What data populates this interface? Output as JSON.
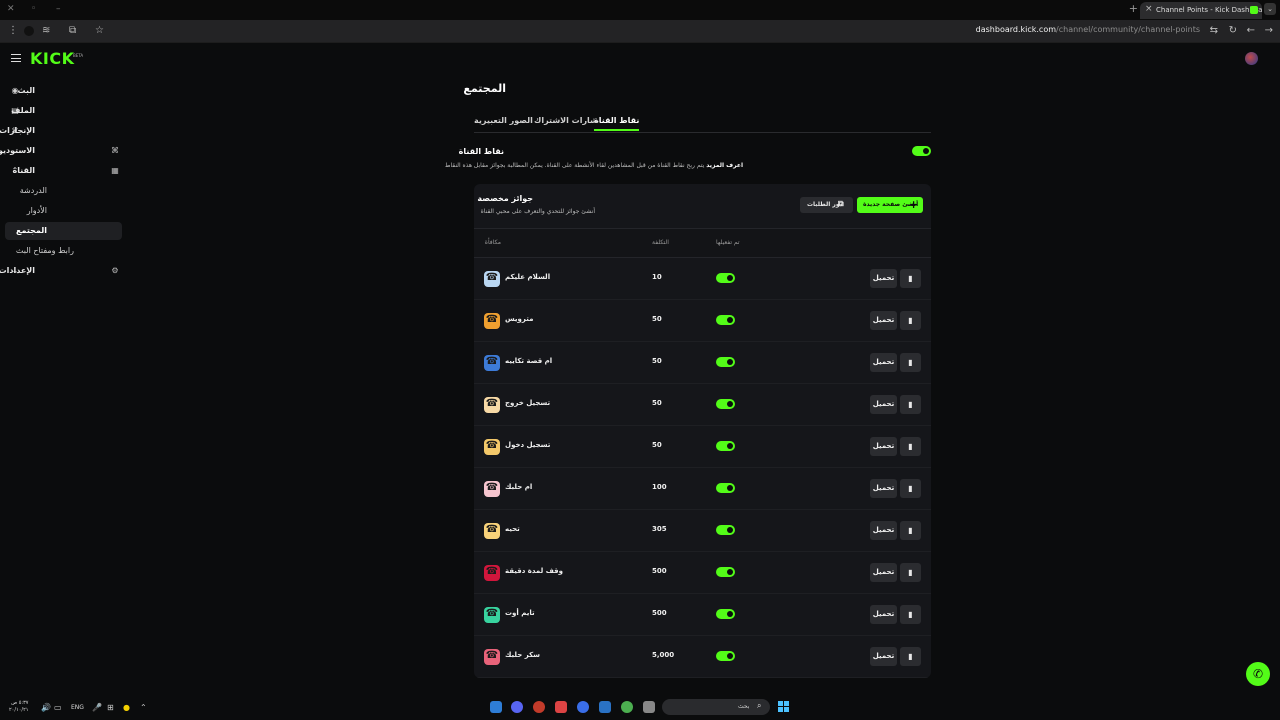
{
  "browser": {
    "tab_title": "Channel Points - Kick Dashboard",
    "url_host": "dashboard.kick.com",
    "url_path": "/channel/community/channel-points",
    "new_tab_glyph": "+",
    "tab_close_glyph": "×",
    "menu_glyph": "⌄"
  },
  "app": {
    "logo": "KICK",
    "logo_badge": "BETA"
  },
  "sidebar": {
    "items": [
      {
        "label": "البث",
        "icon": "broadcast-icon",
        "glyph": "((•))"
      },
      {
        "label": "الملف",
        "icon": "profile-icon",
        "glyph": "▤"
      },
      {
        "label": "الإنجازات",
        "icon": "trophy-icon",
        "glyph": "🏆"
      },
      {
        "label": "الاستوديو",
        "icon": "studio-icon",
        "glyph": "⌄",
        "right_glyph": "⌘"
      },
      {
        "label": "القناة",
        "icon": "channel-icon",
        "glyph": "⌃",
        "right_glyph": "▦"
      },
      {
        "label": "الدردشة",
        "sub": true
      },
      {
        "label": "الأدوار",
        "sub": true
      },
      {
        "label": "المجتمع",
        "sub": true,
        "active": true
      },
      {
        "label": "رابط ومفتاح البث",
        "sub": true
      },
      {
        "label": "الإعدادات",
        "icon": "settings-icon",
        "glyph": "⌄",
        "right_glyph": "⚙"
      }
    ]
  },
  "main": {
    "title": "المجتمع",
    "tabs": [
      {
        "label": "نقاط القناة",
        "active": true
      },
      {
        "label": "شارات الاشتراك"
      },
      {
        "label": "الصور التعبيرية"
      }
    ],
    "section_title": "نقاط القناة",
    "section_desc_bold": "اعرف المزيد",
    "section_desc": "يتم ربح نقاط القناة من قبل المشاهدين لقاء الأنشطة على القناة. يمكن المطالبة بجوائز مقابل هذه النقاط",
    "card": {
      "title": "جوائز مخصصة",
      "subtitle": "أنشئ جوائز للتحدي والتعرف على محبي القناة",
      "create_button": "أنشئ صفحة جديدة",
      "history_button": "دور الطلبات",
      "columns": {
        "reward": "مكافأة",
        "cost": "التكلفة",
        "enabled": "تم تفعيلها"
      },
      "edit_label": "تحميل",
      "delete_glyph": "🗑",
      "rows": [
        {
          "name": "السلام عليكم",
          "cost": "10",
          "color": "#b9d6f2"
        },
        {
          "name": "مترويس",
          "cost": "50",
          "color": "#f0a030"
        },
        {
          "name": "ام قصة تكاييه",
          "cost": "50",
          "color": "#3d7bd8"
        },
        {
          "name": "تسجيل خروج",
          "cost": "50",
          "color": "#f7d9a6"
        },
        {
          "name": "تسجيل دخول",
          "cost": "50",
          "color": "#f3c86a"
        },
        {
          "name": "ام حلبك",
          "cost": "100",
          "color": "#f6c5cf"
        },
        {
          "name": "تحيه",
          "cost": "305",
          "color": "#f8d27a"
        },
        {
          "name": "وقف لمدة دقيقة",
          "cost": "500",
          "color": "#d2163c"
        },
        {
          "name": "تايم أوت",
          "cost": "500",
          "color": "#38d39f"
        },
        {
          "name": "سكر حلبك",
          "cost": "5,000",
          "color": "#e8637a"
        }
      ]
    }
  },
  "taskbar": {
    "time": "٥:٣٧ ص",
    "date": "٢٠/١٠/٢١",
    "lang": "ENG",
    "search": "بحث"
  }
}
